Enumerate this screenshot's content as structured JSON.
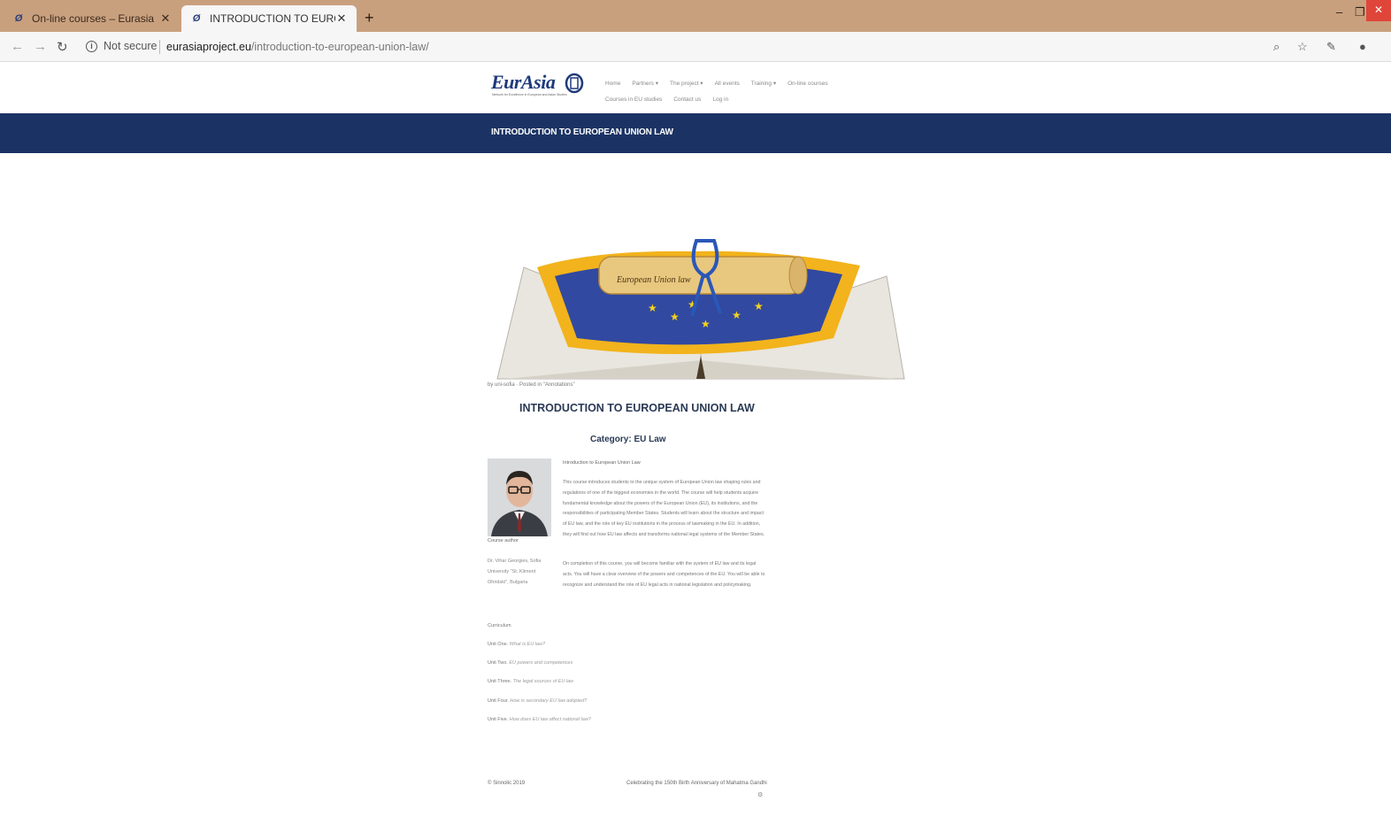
{
  "browser": {
    "tabs": [
      {
        "title": "On-line courses – Eurasia",
        "active": false
      },
      {
        "title": "INTRODUCTION TO EUROPEAN",
        "active": true
      }
    ],
    "new_tab": "+",
    "security_label": "Not secure",
    "url_domain": "eurasiaproject.eu",
    "url_path": "/introduction-to-european-union-law/",
    "accent_color": "#c9a07e"
  },
  "site": {
    "logo_text": "EurAsia",
    "logo_tagline": "Network for Excellence in European and Asian Studies",
    "nav": [
      "Home",
      "Partners ▾",
      "The project ▾",
      "All events",
      "Training ▾",
      "On-line courses",
      "Courses in EU studies",
      "Contact us",
      "Log in"
    ],
    "header_color": "#1b3364"
  },
  "page": {
    "title": "INTRODUCTION TO EUROPEAN UNION LAW",
    "hero_scroll_text": "European Union law",
    "meta": "by uni-sofia  ·  Posted in \"Annotations\"",
    "post_title": "INTRODUCTION TO EUROPEAN UNION LAW",
    "category": "Category: EU Law",
    "author_label": "Course author",
    "author_name": "Dr. Vihar Georgiev, Sofia University \"St. Kliment Ohridski\", Bulgaria",
    "intro_heading": "Introduction to European Union Law",
    "paragraph1": "This course introduces students to the unique system of European Union law shaping rules and regulations of one of the biggest economies in the world. The course will help students acquire fundamental knowledge about the powers of the European Union (EU), its institutions, and the responsibilities of participating Member States. Students will learn about the structure and impact of EU law, and the role of key EU institutions in the process of lawmaking in the EU. In addition, they will find out how EU law affects and transforms national legal systems of the Member States.",
    "paragraph2": "On completion of this course, you will become familiar with the system of EU law and its legal acts. You will have a clear overview of the powers and competences of the EU. You will be able to recognize and understand the role of EU legal acts in national legislation and policymaking.",
    "curriculum_heading": "Curriculum",
    "units": [
      {
        "label": "Unit One.",
        "title": "What is EU law?"
      },
      {
        "label": "Unit Two.",
        "title": "EU powers and competences"
      },
      {
        "label": "Unit Three.",
        "title": "The legal sources of EU law"
      },
      {
        "label": "Unit Four.",
        "title": "How is secondary EU law adopted?"
      },
      {
        "label": "Unit Five.",
        "title": "How does EU law affect national law?"
      }
    ]
  },
  "footer": {
    "copyright": "© Sinnolic 2019",
    "celebration": "Celebrating the 150th Birth Anniversary of Mahatma Gandhi",
    "dot": "⚙"
  }
}
